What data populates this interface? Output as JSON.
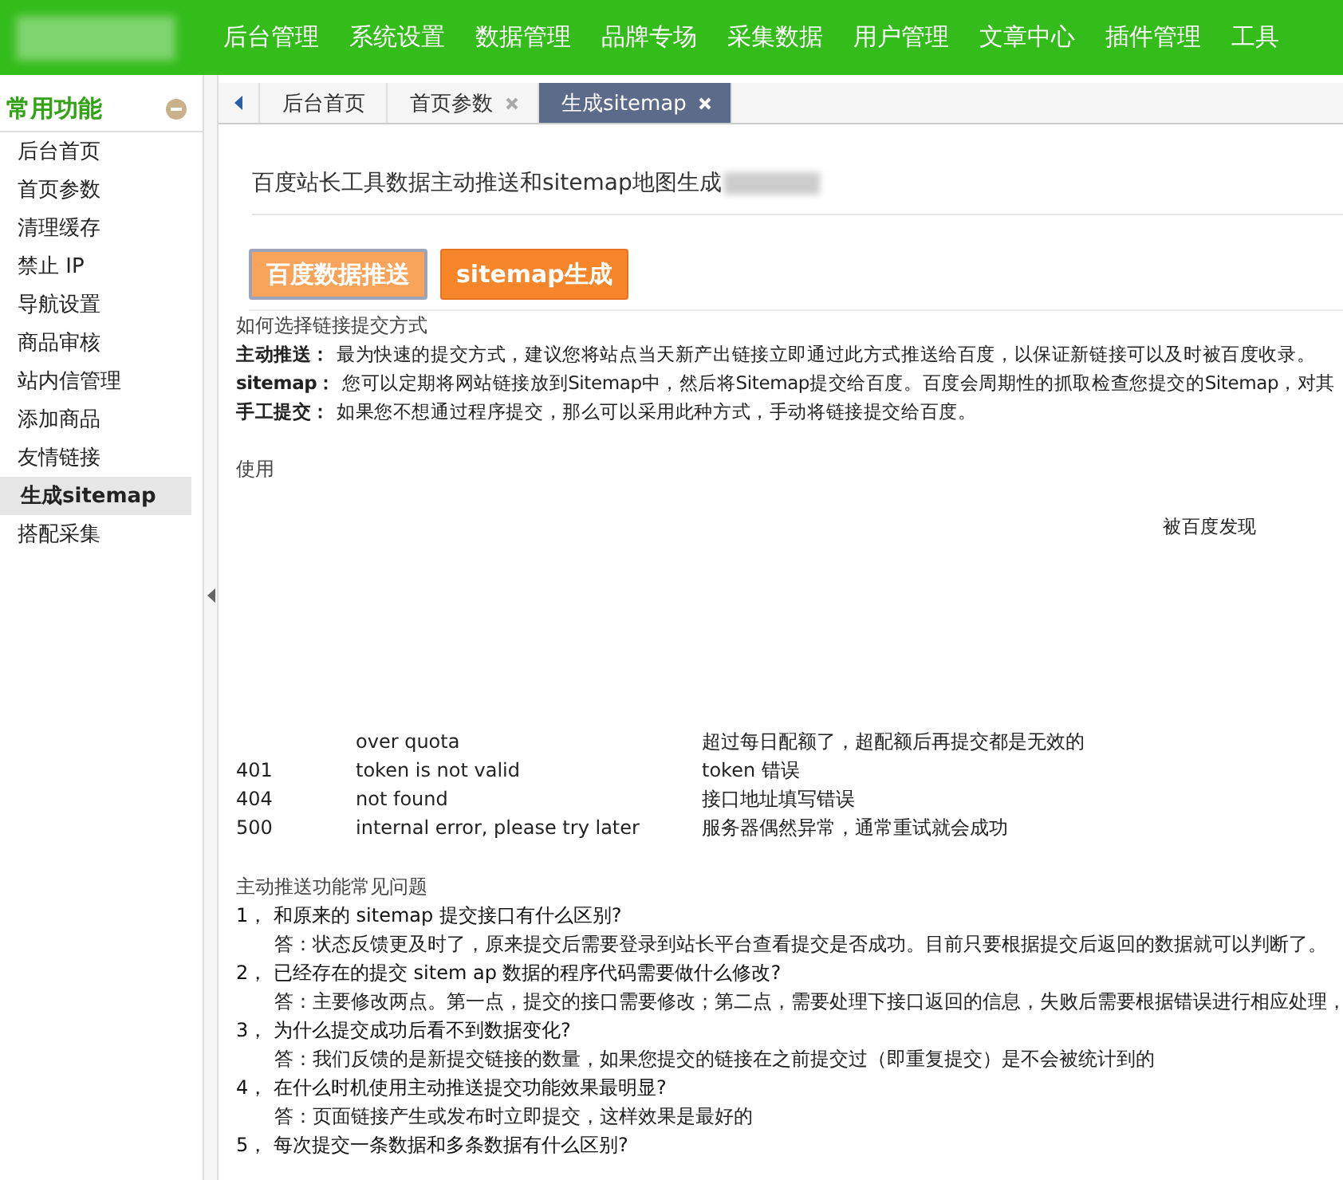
{
  "header": {
    "nav": [
      "后台管理",
      "系统设置",
      "数据管理",
      "品牌专场",
      "采集数据",
      "用户管理",
      "文章中心",
      "插件管理",
      "工具"
    ]
  },
  "sidebar": {
    "title": "常用功能",
    "items": [
      {
        "label": "后台首页",
        "selected": false
      },
      {
        "label": "首页参数",
        "selected": false
      },
      {
        "label": "清理缓存",
        "selected": false
      },
      {
        "label": "禁止 IP",
        "selected": false
      },
      {
        "label": "导航设置",
        "selected": false
      },
      {
        "label": "商品审核",
        "selected": false
      },
      {
        "label": "站内信管理",
        "selected": false
      },
      {
        "label": "添加商品",
        "selected": false
      },
      {
        "label": "友情链接",
        "selected": false
      },
      {
        "label": "生成sitemap",
        "selected": true
      },
      {
        "label": "搭配采集",
        "selected": false
      }
    ]
  },
  "tabs": [
    {
      "label": "后台首页",
      "selected": false,
      "closable": false
    },
    {
      "label": "首页参数",
      "selected": false,
      "closable": true
    },
    {
      "label": "生成sitemap",
      "selected": true,
      "closable": true
    }
  ],
  "page_title": "百度站长工具数据主动推送和sitemap地图生成",
  "buttons": [
    {
      "label": "百度数据推送",
      "selected": true
    },
    {
      "label": "sitemap生成",
      "selected": false
    }
  ],
  "intro": {
    "heading": "如何选择链接提交方式",
    "lines": [
      {
        "term": "主动推送：",
        "text": "最为快速的提交方式，建议您将站点当天新产出链接立即通过此方式推送给百度，以保证新链接可以及时被百度收录。"
      },
      {
        "term": "sitemap：",
        "text": "您可以定期将网站链接放到Sitemap中，然后将Sitemap提交给百度。百度会周期性的抓取检查您提交的Sitemap，对其"
      },
      {
        "term": "手工提交：",
        "text": "如果您不想通过程序提交，那么可以采用此种方式，手动将链接提交给百度。"
      }
    ]
  },
  "usage": {
    "heading": "使用",
    "note": "被百度发现"
  },
  "errors": [
    {
      "message": "over quota",
      "description": "超过每日配额了，超配额后再提交都是无效的"
    },
    {
      "code": "401",
      "message": "token is not valid",
      "description": "token 错误"
    },
    {
      "code": "404",
      "message": "not found",
      "description": "接口地址填写错误"
    },
    {
      "code": "500",
      "message": "internal error, please try later",
      "description": "服务器偶然异常，通常重试就会成功"
    }
  ],
  "faq": {
    "heading": "主动推送功能常见问题",
    "items": [
      {
        "number": "1，",
        "question": "和原来的 sitemap 提交接口有什么区别?",
        "answer": "答：状态反馈更及时了，原来提交后需要登录到站长平台查看提交是否成功。目前只要根据提交后返回的数据就可以判断了。"
      },
      {
        "number": "2，",
        "question": "已经存在的提交 sitem ap 数据的程序代码需要做什么修改?",
        "answer": "答：主要修改两点。第一点，提交的接口需要修改；第二点，需要处理下接口返回的信息，失败后需要根据错误进行相应处理，"
      },
      {
        "number": "3，",
        "question": "为什么提交成功后看不到数据变化?",
        "answer": "答：我们反馈的是新提交链接的数量，如果您提交的链接在之前提交过（即重复提交）是不会被统计到的"
      },
      {
        "number": "4，",
        "question": "在什么时机使用主动推送提交功能效果最明显?",
        "answer": "答：页面链接产生或发布时立即提交，这样效果是最好的"
      },
      {
        "number": "5，",
        "question": "每次提交一条数据和多条数据有什么区别?"
      }
    ]
  }
}
